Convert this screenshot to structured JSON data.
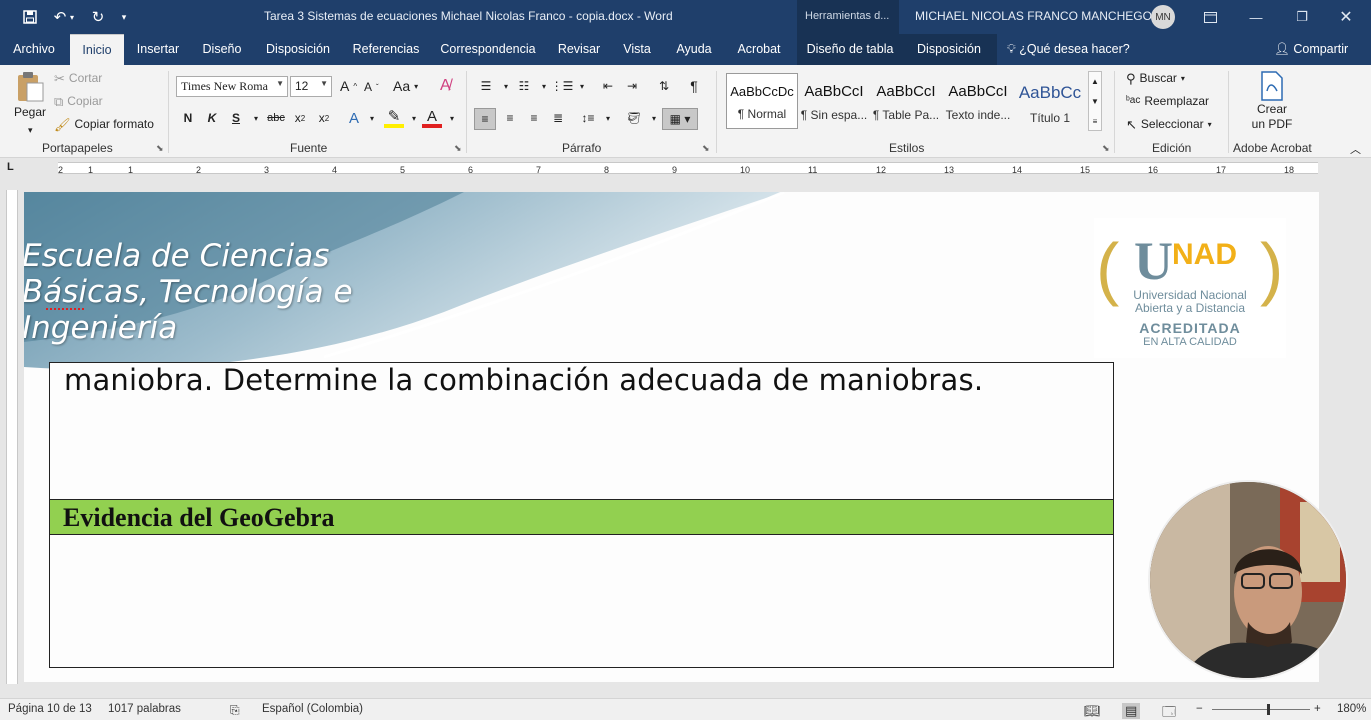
{
  "titlebar": {
    "doc_title": "Tarea 3 Sistemas de ecuaciones Michael Nicolas Franco - copia.docx  -  Word",
    "context_tools": "Herramientas d...",
    "user_name": "MICHAEL NICOLAS FRANCO MANCHEGO",
    "user_initials": "MN"
  },
  "tabs": [
    {
      "label": "Archivo"
    },
    {
      "label": "Inicio"
    },
    {
      "label": "Insertar"
    },
    {
      "label": "Diseño"
    },
    {
      "label": "Disposición"
    },
    {
      "label": "Referencias"
    },
    {
      "label": "Correspondencia"
    },
    {
      "label": "Revisar"
    },
    {
      "label": "Vista"
    },
    {
      "label": "Ayuda"
    },
    {
      "label": "Acrobat"
    },
    {
      "label": "Diseño de tabla"
    },
    {
      "label": "Disposición"
    }
  ],
  "help_search": "¿Qué desea hacer?",
  "share": "Compartir",
  "clipboard": {
    "paste": "Pegar",
    "cut": "Cortar",
    "copy": "Copiar",
    "format_painter": "Copiar formato",
    "group": "Portapapeles"
  },
  "font": {
    "family": "Times New Roma",
    "size": "12",
    "group": "Fuente"
  },
  "paragraph": {
    "group": "Párrafo"
  },
  "styles": {
    "group": "Estilos",
    "items": [
      {
        "preview": "AaBbCcDc",
        "name": "¶ Normal"
      },
      {
        "preview": "AaBbCcI",
        "name": "¶ Sin espa..."
      },
      {
        "preview": "AaBbCcI",
        "name": "¶ Table Pa..."
      },
      {
        "preview": "AaBbCcI",
        "name": "Texto inde..."
      },
      {
        "preview": "AaBbCc",
        "name": "Título 1"
      }
    ]
  },
  "editing": {
    "find": "Buscar",
    "replace": "Reemplazar",
    "select": "Seleccionar",
    "group": "Edición"
  },
  "acrobat": {
    "create_pdf_1": "Crear",
    "create_pdf_2": "un PDF",
    "group": "Adobe Acrobat"
  },
  "ruler_numbers": [
    "2",
    "1",
    "1",
    "2",
    "3",
    "4",
    "5",
    "6",
    "7",
    "8",
    "9",
    "10",
    "11",
    "12",
    "13",
    "14",
    "15",
    "16",
    "17",
    "18"
  ],
  "document": {
    "banner_line1": "Escuela de Ciencias",
    "banner_line2": "Básicas, Tecnología e",
    "banner_line3": "Ingeniería",
    "logo_u": "U",
    "logo_nad": "NAD",
    "logo_line1": "Universidad Nacional",
    "logo_line2": "Abierta y a Distancia",
    "logo_line3": "ACREDITADA",
    "logo_line4": "EN ALTA CALIDAD",
    "body_text": "maniobra. Determine la combinación adecuada de maniobras.",
    "section_heading": "Evidencia del GeoGebra"
  },
  "status": {
    "page": "Página 10 de 13",
    "words": "1017 palabras",
    "language": "Español (Colombia)",
    "zoom": "180%"
  },
  "colors": {
    "titlebar": "#1f3f6b",
    "table_header": "#92d050",
    "logo_gold": "#f2b018",
    "logo_gray": "#6f8d9c"
  }
}
